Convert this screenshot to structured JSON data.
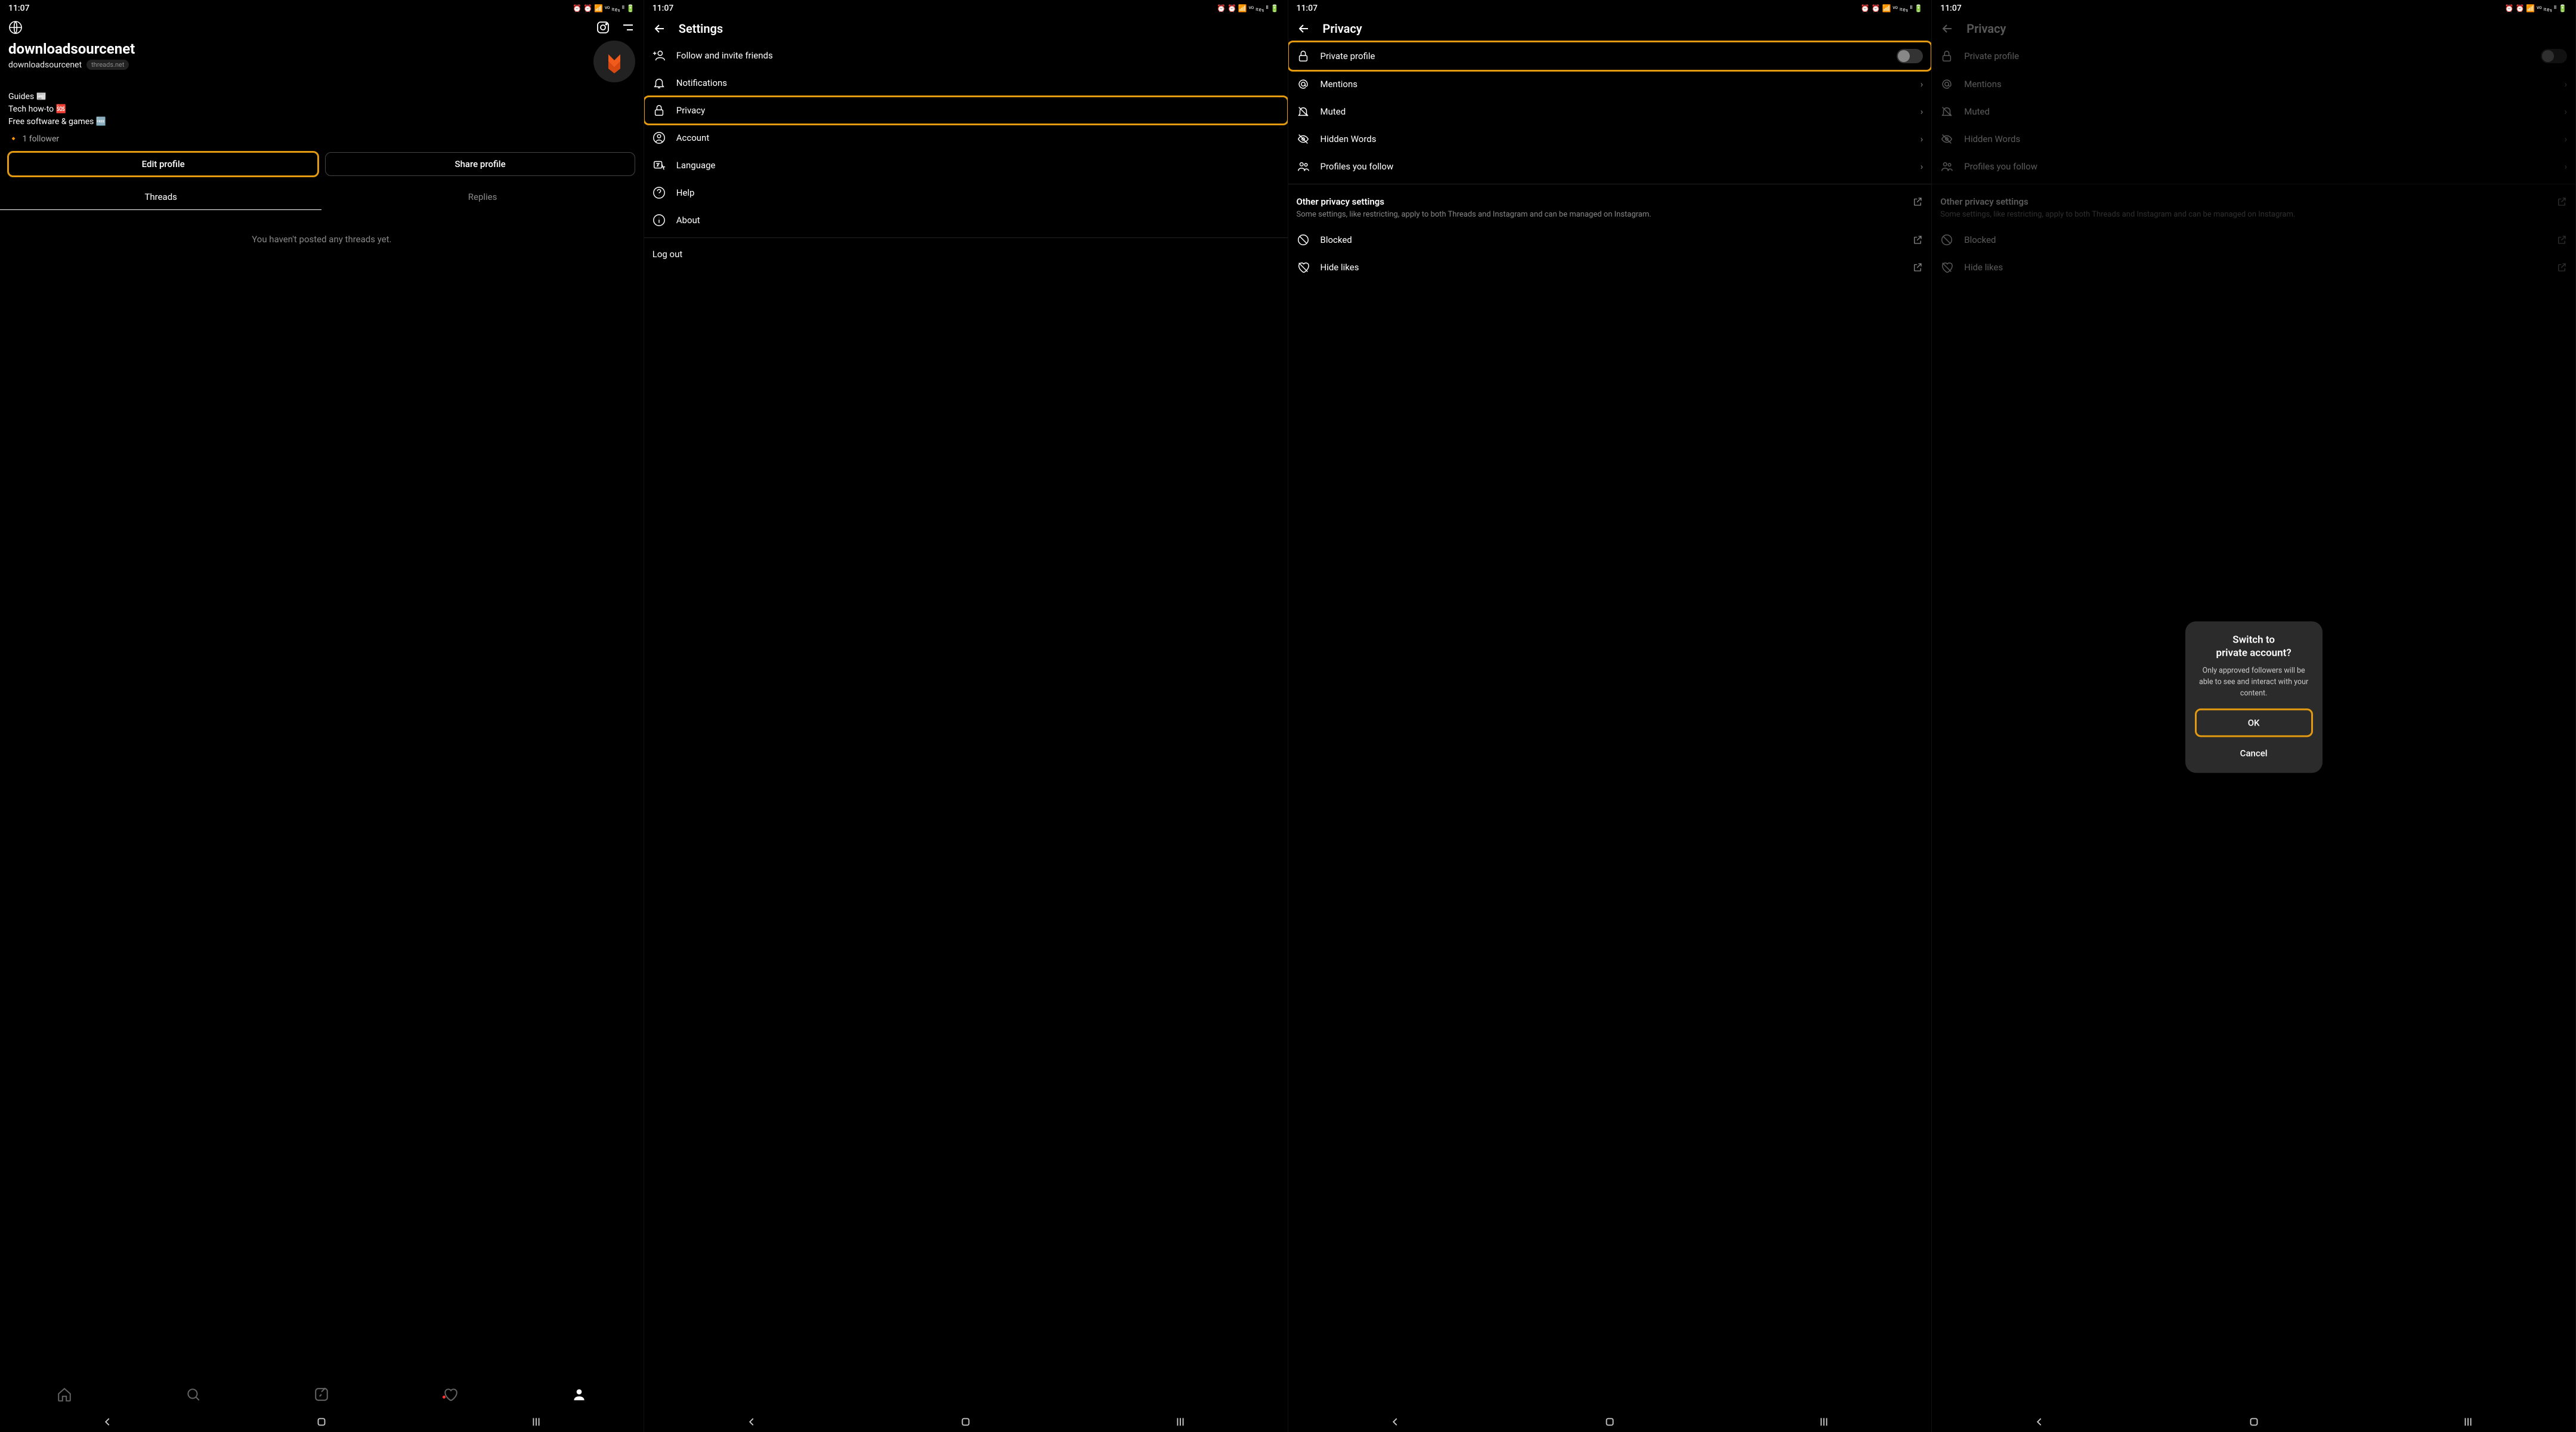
{
  "status": {
    "time": "11:07",
    "icons": "⏰ ⏰ 📶 ᵛᵒ ₗₜₑ₁ ᴵᴵ 🔋"
  },
  "screen1": {
    "username": "downloadsourcenet",
    "handle": "downloadsourcenet",
    "badge": "threads.net",
    "bio1": "Guides 📰",
    "bio2": "Tech how-to 🆘",
    "bio3": "Free software & games 🆓",
    "followers": "1 follower",
    "edit_btn": "Edit profile",
    "share_btn": "Share profile",
    "tab_threads": "Threads",
    "tab_replies": "Replies",
    "empty": "You haven't posted any threads yet."
  },
  "screen2": {
    "title": "Settings",
    "items": [
      "Follow and invite friends",
      "Notifications",
      "Privacy",
      "Account",
      "Language",
      "Help",
      "About"
    ],
    "logout": "Log out"
  },
  "screen3": {
    "title": "Privacy",
    "private": "Private profile",
    "mentions": "Mentions",
    "muted": "Muted",
    "hidden": "Hidden Words",
    "profiles": "Profiles you follow",
    "other_hdr": "Other privacy settings",
    "other_desc": "Some settings, like restricting, apply to both Threads and Instagram and can be managed on Instagram.",
    "blocked": "Blocked",
    "hide_likes": "Hide likes"
  },
  "dialog": {
    "title1": "Switch to",
    "title2": "private account?",
    "body": "Only approved followers will be able to see and interact with your content.",
    "ok": "OK",
    "cancel": "Cancel"
  }
}
